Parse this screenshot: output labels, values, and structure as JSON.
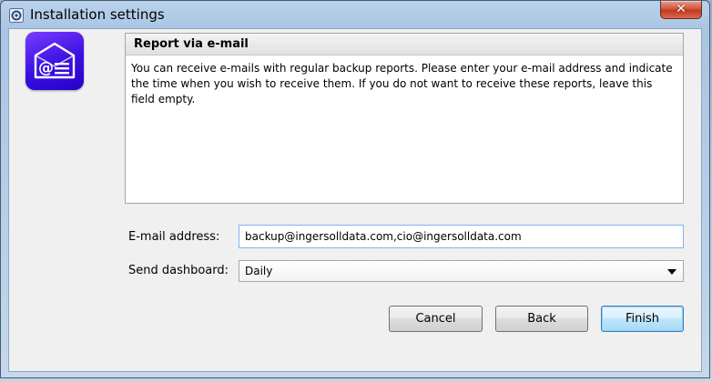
{
  "window": {
    "title": "Installation settings"
  },
  "report": {
    "title": "Report via e-mail",
    "description": "You can receive e-mails with regular backup reports. Please enter your e-mail address and indicate the time when you wish to receive them. If you do not want to receive these reports, leave this field empty."
  },
  "form": {
    "email_label": "E-mail address:",
    "email_value": "backup@ingersolldata.com,cio@ingersolldata.com",
    "dashboard_label": "Send dashboard:",
    "dashboard_value": "Daily"
  },
  "buttons": {
    "cancel": "Cancel",
    "back": "Back",
    "finish": "Finish"
  },
  "icons": {
    "title": "settings-gear-icon",
    "app": "email-envelope-icon",
    "close": "close-icon",
    "dropdown": "chevron-down-icon"
  },
  "colors": {
    "accent": "#3a10e0",
    "default_button": "#3c7fb1"
  }
}
